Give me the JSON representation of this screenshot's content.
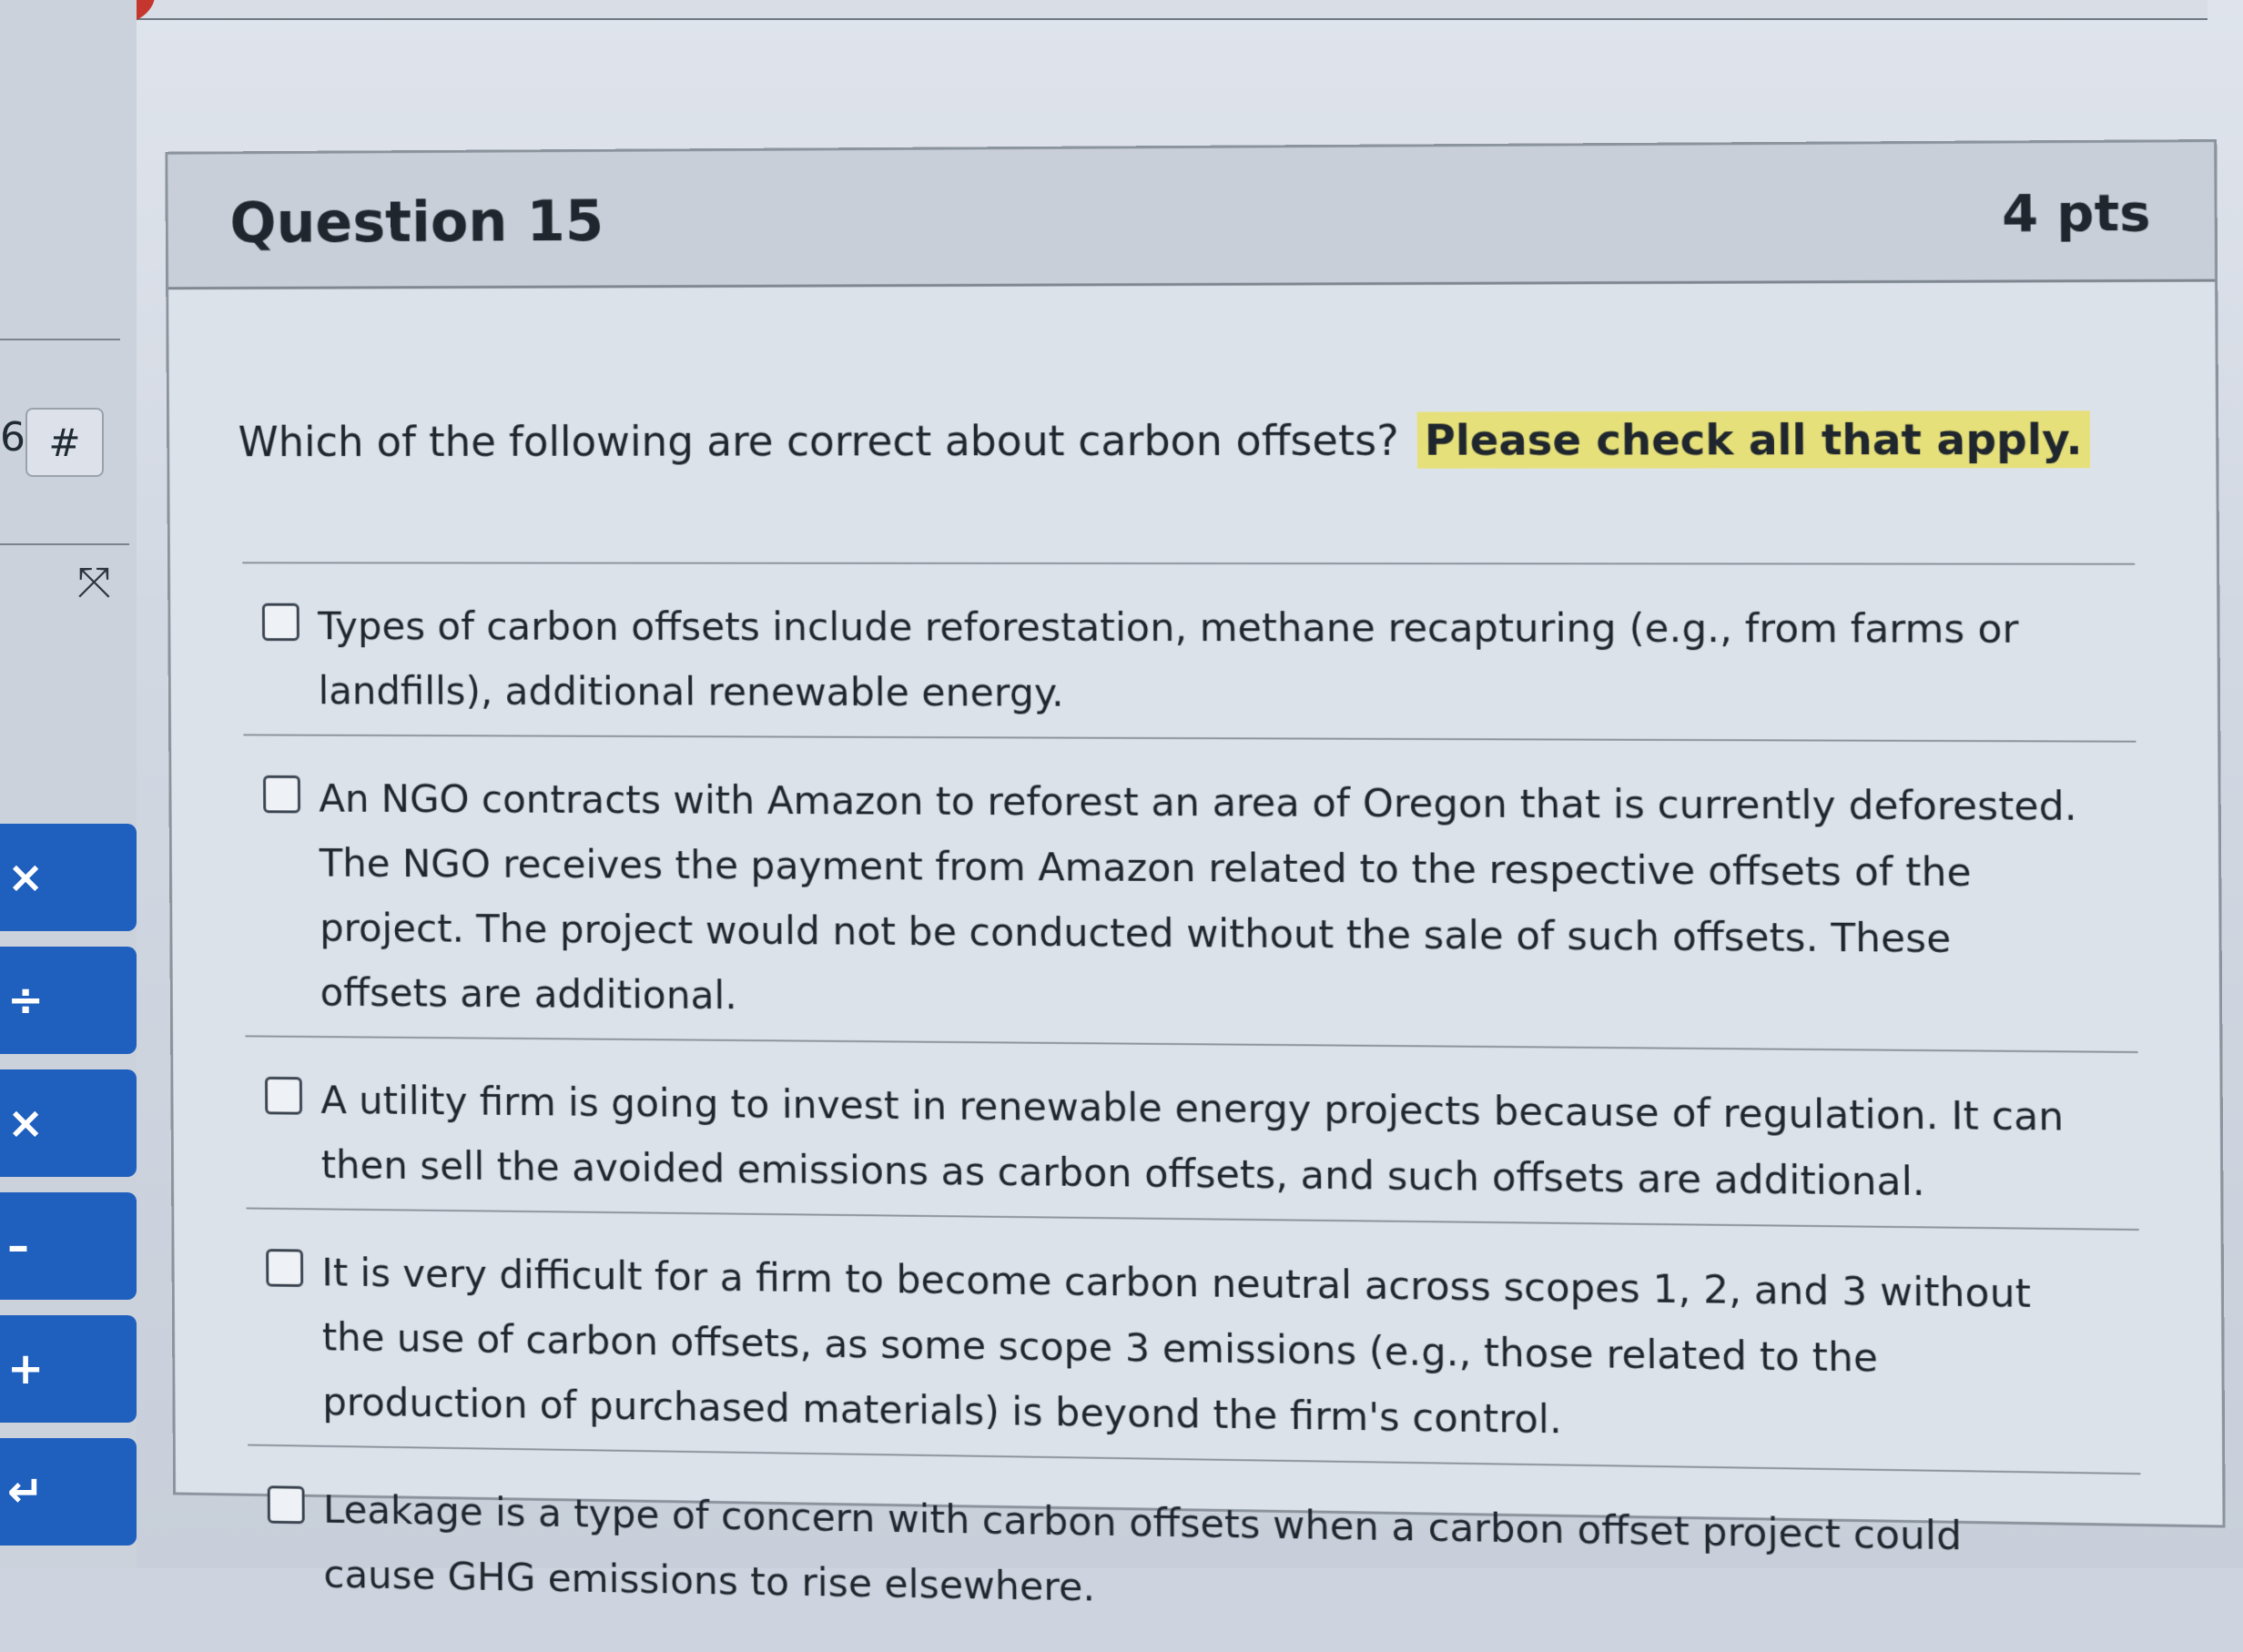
{
  "window": {
    "accent_red": "#c5362e"
  },
  "left_panel": {
    "question_number_fragment": "6",
    "hash_label": "#",
    "collapse_icon": "collapse-arrows-icon",
    "calculator_buttons": [
      {
        "name": "multiply-button",
        "label": "×"
      },
      {
        "name": "divide-button",
        "label": "÷"
      },
      {
        "name": "times-button",
        "label": "×"
      },
      {
        "name": "minus-button",
        "label": "–"
      },
      {
        "name": "plus-button",
        "label": "+"
      },
      {
        "name": "enter-button",
        "label": "↵"
      }
    ],
    "button_color": "#1f5fbe"
  },
  "question": {
    "title": "Question 15",
    "points": "4 pts",
    "prompt": "Which of the following are correct about carbon offsets?",
    "instruction": "Please check all that apply.",
    "highlight_color": "#e6e07a"
  },
  "answers": [
    {
      "checked": false,
      "text": "Types of carbon offsets include reforestation, methane recapturing (e.g., from farms or landfills), additional renewable energy."
    },
    {
      "checked": false,
      "text": "An NGO contracts with Amazon to reforest an area of Oregon that is currently deforested. The NGO receives the payment from Amazon related to the respective offsets of the project. The project would not be conducted without the sale of such offsets. These offsets are additional."
    },
    {
      "checked": false,
      "text": "A utility firm is going to invest in renewable energy projects because of regulation. It can then sell the avoided emissions as carbon offsets, and such offsets are additional."
    },
    {
      "checked": false,
      "text": "It is very difficult for a firm to become carbon neutral across scopes 1, 2, and 3 without the use of carbon offsets, as some scope 3 emissions (e.g., those related to the production of purchased materials) is beyond the firm's control."
    },
    {
      "checked": false,
      "text": "Leakage is a type of concern with carbon offsets when a carbon offset project could cause GHG emissions to rise elsewhere."
    }
  ]
}
